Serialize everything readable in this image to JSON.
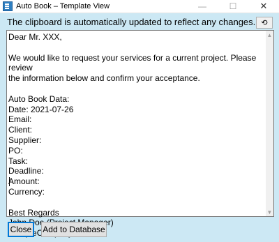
{
  "window": {
    "title": "Auto Book – Template View",
    "minimize_glyph": "—",
    "maximize_glyph": "☐",
    "close_glyph": "✕"
  },
  "info": {
    "message": "The clipboard is automatically updated to reflect any changes.",
    "refresh_glyph": "⟲"
  },
  "editor": {
    "lines": [
      "Dear Mr. XXX,",
      "",
      "We would like to request your services for a current project. Please review",
      "the information below and confirm your acceptance.",
      "",
      "Auto Book Data:",
      "Date: 2021-07-26",
      "Email:",
      "Client:",
      "Supplier:",
      "PO:",
      "Task:",
      "Deadline:",
      "Amount:",
      "Currency:",
      "",
      "Best Regards",
      "John Doe (Project Manager)",
      "SampleCompany, Ltd."
    ],
    "scroll_up_glyph": "▲",
    "scroll_down_glyph": "▼"
  },
  "buttons": {
    "close_label": "Close",
    "add_label": "Add to Database"
  }
}
